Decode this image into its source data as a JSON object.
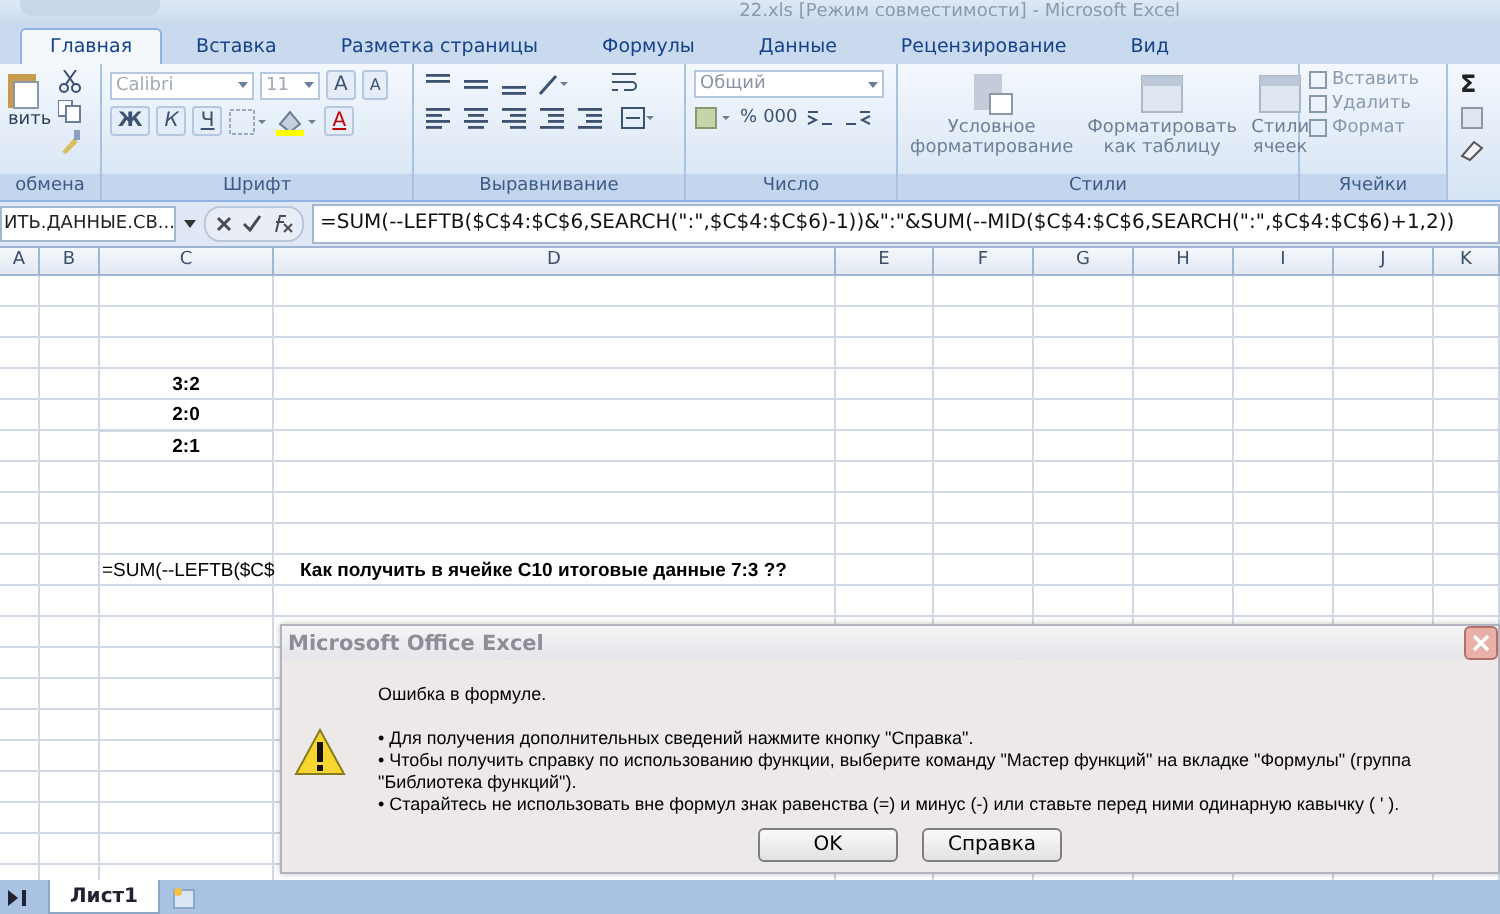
{
  "window": {
    "title": "22.xls  [Режим совместимости] - Microsoft Excel"
  },
  "ribbon_tabs": [
    {
      "label": "Главная",
      "selected": true
    },
    {
      "label": "Вставка",
      "selected": false
    },
    {
      "label": "Разметка страницы",
      "selected": false
    },
    {
      "label": "Формулы",
      "selected": false
    },
    {
      "label": "Данные",
      "selected": false
    },
    {
      "label": "Рецензирование",
      "selected": false
    },
    {
      "label": "Вид",
      "selected": false
    }
  ],
  "clipboard": {
    "label": "обмена",
    "paste": "вить"
  },
  "font": {
    "label": "Шрифт",
    "name": "Calibri",
    "size": "11",
    "grow": "A",
    "shrink": "A",
    "bold": "Ж",
    "italic": "К",
    "underline": "Ч",
    "color_letter": "A"
  },
  "alignment": {
    "label": "Выравнивание"
  },
  "number": {
    "label": "Число",
    "format": "Общий",
    "percent": "%",
    "thousands": "000"
  },
  "styles": {
    "label": "Стили",
    "buttons": [
      "Условное форматирование",
      "Форматировать как таблицу",
      "Стили ячеек"
    ]
  },
  "cells": {
    "label": "Ячейки",
    "buttons": [
      "Вставить",
      "Удалить",
      "Формат"
    ]
  },
  "editing": {
    "sum": "Σ"
  },
  "formula_bar": {
    "name_box": "ИТЬ.ДАННЫЕ.СВ...",
    "formula": "=SUM(--LEFTB($C$4:$C$6,SEARCH(\":\",$C$4:$C$6)-1))&\":\"&SUM(--MID($C$4:$C$6,SEARCH(\":\",$C$4:$C$6)+1,2))"
  },
  "sheet": {
    "columns": [
      "A",
      "B",
      "C",
      "D",
      "E",
      "F",
      "G",
      "H",
      "I",
      "J",
      "K"
    ],
    "rows": [
      {},
      {},
      {},
      {
        "C": {
          "text": "3:2",
          "bold": true
        }
      },
      {
        "C": {
          "text": "2:0",
          "bold": true
        }
      },
      {
        "C": {
          "text": "2:1",
          "bold": true
        }
      },
      {},
      {},
      {},
      {
        "C": {
          "text": "=SUM(--LEFTB($C$",
          "bold": false
        },
        "D": {
          "text": "Как получить в ячейке С10 итоговые данные 7:3 ??",
          "bold": true
        }
      }
    ]
  },
  "dialog": {
    "title": "Microsoft Office Excel",
    "heading": "Ошибка в формуле.",
    "bullets": [
      "• Для получения дополнительных сведений нажмите кнопку \"Справка\".",
      "• Чтобы получить справку по использованию функции, выберите команду \"Мастер функций\" на вкладке \"Формулы\" (группа \"Библиотека функций\").",
      "• Старайтесь не использовать вне формул знак равенства (=) и минус (-) или ставьте перед ними одинарную кавычку ( ' )."
    ],
    "buttons": [
      "OK",
      "Справка"
    ]
  },
  "sheet_tabs": [
    {
      "label": "Лист1",
      "selected": true
    }
  ]
}
